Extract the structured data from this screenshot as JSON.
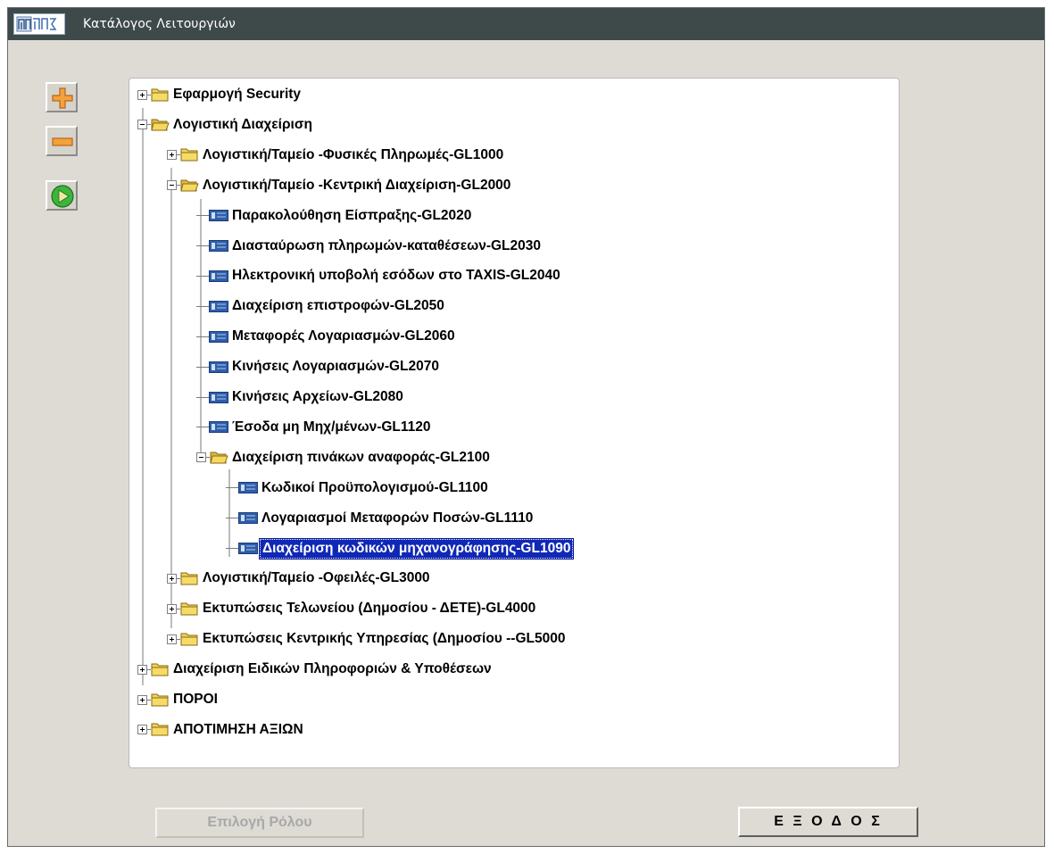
{
  "window": {
    "title": "Κατάλογος Λειτουργιών",
    "app_icon": "ΓΓΠΣ"
  },
  "toolbar": {
    "expand_icon": "plus-icon",
    "collapse_icon": "minus-icon",
    "run_icon": "play-icon"
  },
  "tree": [
    {
      "label": "Εφαρμογή Security",
      "type": "folder",
      "expanded": false,
      "selected": false
    },
    {
      "label": "Λογιστική Διαχείριση",
      "type": "folder",
      "expanded": true,
      "selected": false
    },
    {
      "label": "Λογιστική/Ταμείο -Φυσικές Πληρωμές-GL1000",
      "type": "folder",
      "expanded": false,
      "selected": false
    },
    {
      "label": "Λογιστική/Ταμείο -Κεντρική Διαχείριση-GL2000",
      "type": "folder",
      "expanded": true,
      "selected": false
    },
    {
      "label": "Παρακολούθηση Είσπραξης-GL2020",
      "type": "form",
      "selected": false
    },
    {
      "label": "Διασταύρωση πληρωμών-καταθέσεων-GL2030",
      "type": "form",
      "selected": false
    },
    {
      "label": "Ηλεκτρονική υποβολή εσόδων στο TAXIS-GL2040",
      "type": "form",
      "selected": false
    },
    {
      "label": "Διαχείριση επιστροφών-GL2050",
      "type": "form",
      "selected": false
    },
    {
      "label": "Μεταφορές Λογαριασμών-GL2060",
      "type": "form",
      "selected": false
    },
    {
      "label": "Κινήσεις Λογαριασμών-GL2070",
      "type": "form",
      "selected": false
    },
    {
      "label": "Κινήσεις Αρχείων-GL2080",
      "type": "form",
      "selected": false
    },
    {
      "label": "Έσοδα μη Μηχ/μένων-GL1120",
      "type": "form",
      "selected": false
    },
    {
      "label": "Διαχείριση πινάκων αναφοράς-GL2100",
      "type": "folder",
      "expanded": true,
      "selected": false
    },
    {
      "label": "Κωδικοί Προϋπολογισμού-GL1100",
      "type": "form",
      "selected": false
    },
    {
      "label": "Λογαριασμοί Μεταφορών Ποσών-GL1110",
      "type": "form",
      "selected": false
    },
    {
      "label": "Διαχείριση κωδικών μηχανογράφησης-GL1090",
      "type": "form",
      "selected": true
    },
    {
      "label": "Λογιστική/Ταμείο -Οφειλές-GL3000",
      "type": "folder",
      "expanded": false,
      "selected": false
    },
    {
      "label": "Εκτυπώσεις  Τελωνείου (Δημοσίου - ΔΕΤΕ)-GL4000",
      "type": "folder",
      "expanded": false,
      "selected": false
    },
    {
      "label": "Εκτυπώσεις  Κεντρικής Υπηρεσίας (Δημοσίου --GL5000",
      "type": "folder",
      "expanded": false,
      "selected": false
    },
    {
      "label": "Διαχείριση Ειδικών Πληροφοριών & Υποθέσεων",
      "type": "folder",
      "expanded": false,
      "selected": false
    },
    {
      "label": "ΠΟΡΟΙ",
      "type": "folder",
      "expanded": false,
      "selected": false
    },
    {
      "label": "ΑΠΟΤΙΜΗΣΗ ΑΞΙΩΝ",
      "type": "folder",
      "expanded": false,
      "selected": false
    }
  ],
  "buttons": {
    "role": {
      "label": "Επιλογή Ρόλου",
      "enabled": false
    },
    "exit": {
      "label": "Ε Ξ Ο Δ Ο Σ",
      "enabled": true
    }
  },
  "colors": {
    "titlebar": "#3e4a4a",
    "window": "#dedbd5",
    "selection": "#1028b6",
    "folder": "#f2d25e",
    "form_icon": "#2f5ea8"
  }
}
